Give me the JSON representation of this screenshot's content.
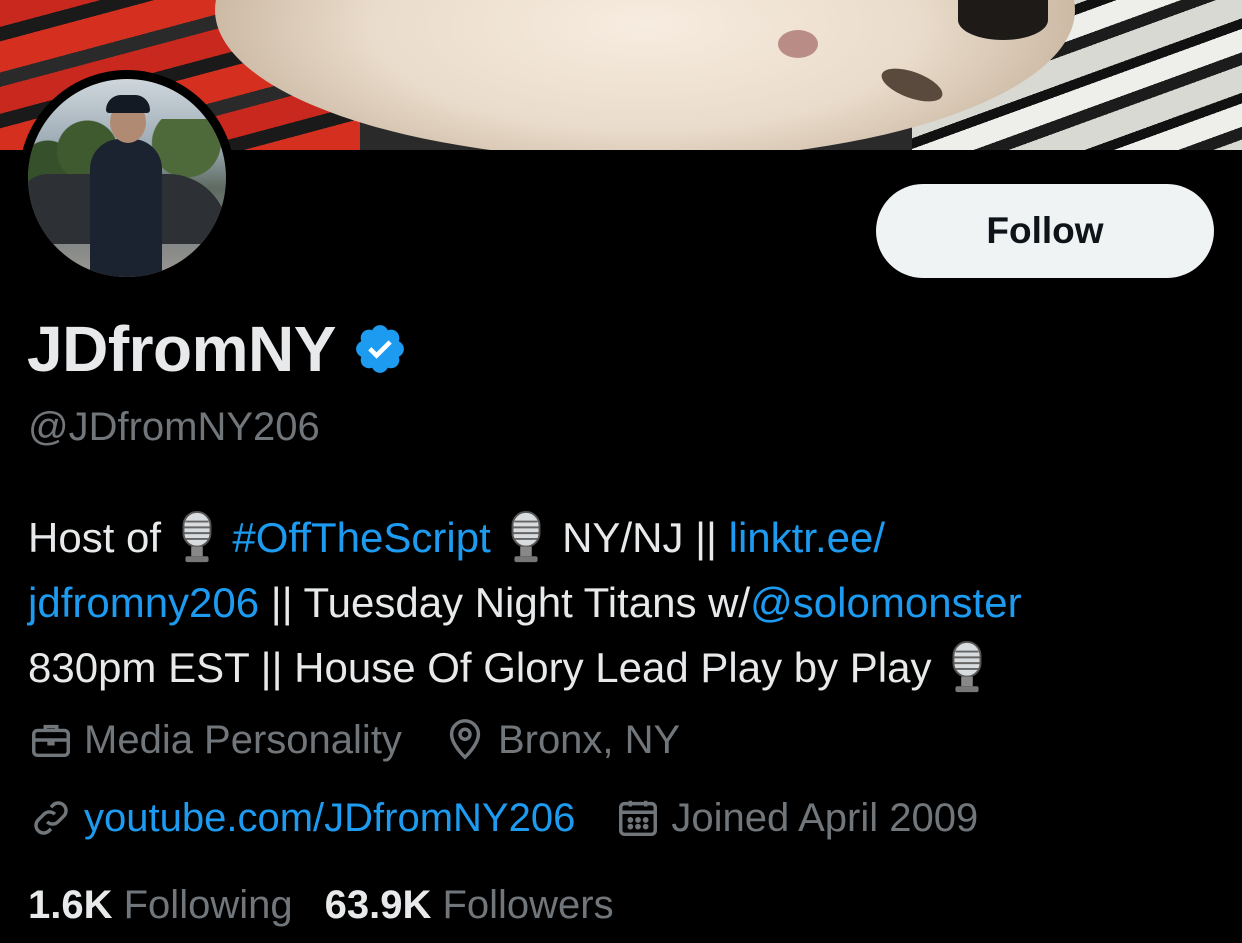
{
  "profile": {
    "display_name": "JDfromNY",
    "handle": "@JDfromNY206",
    "follow_label": "Follow",
    "verified_icon": "verified-badge-icon",
    "accent_color": "#1d9bf0"
  },
  "bio": {
    "line1": {
      "t1": "Host of",
      "hashtag": "#OffTheScript",
      "t2": "NY/NJ ||",
      "link_part1": "linktr.ee/"
    },
    "line2": {
      "link_part2": "jdfromny206",
      "t3": "|| Tuesday Night Titans w/",
      "mention": "@solomonster"
    },
    "line3": {
      "t4": "830pm EST || House Of Glory Lead Play by Play"
    },
    "emoji_icon": "microphone-icon"
  },
  "meta": {
    "category": "Media Personality",
    "location": "Bronx, NY",
    "website": "youtube.com/JDfromNY206",
    "joined": "Joined April 2009"
  },
  "counts": {
    "following_value": "1.6K",
    "following_label": "Following",
    "followers_value": "63.9K",
    "followers_label": "Followers"
  }
}
